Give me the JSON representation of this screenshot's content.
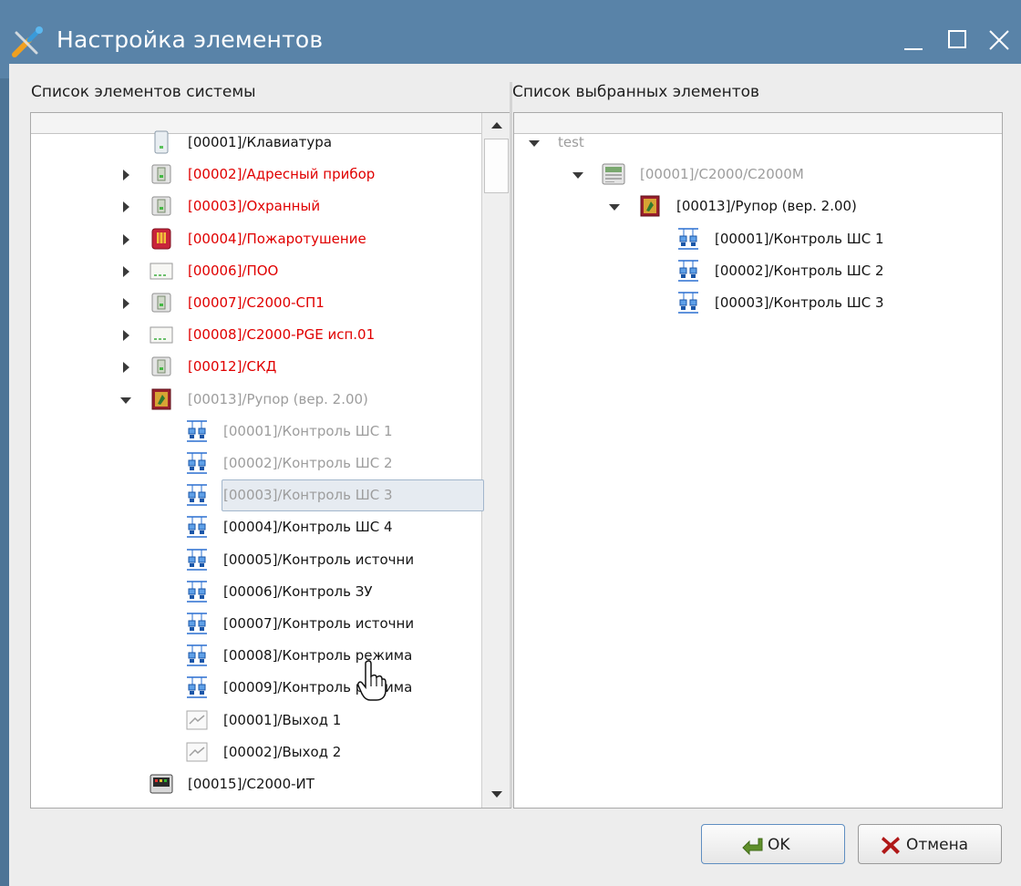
{
  "window": {
    "title": "Настройка элементов",
    "icon": "tools-icon",
    "controls": [
      "minimize-icon",
      "maximize-icon",
      "close-icon"
    ]
  },
  "left_panel": {
    "label": "Список элементов системы",
    "rows": [
      {
        "text": "[00001]/Клавиатура",
        "color": "black",
        "icon": "keyboard-icon",
        "expander": "none",
        "level": 1
      },
      {
        "text": "[00002]/Адресный прибор",
        "color": "red",
        "icon": "device-icon",
        "expander": "collapsed",
        "level": 1
      },
      {
        "text": "[00003]/Охранный",
        "color": "red",
        "icon": "device-icon",
        "expander": "collapsed",
        "level": 1
      },
      {
        "text": "[00004]/Пожаротушение",
        "color": "red",
        "icon": "fire-device-icon",
        "expander": "collapsed",
        "level": 1
      },
      {
        "text": "[00006]/ПОО",
        "color": "red",
        "icon": "panel-device-icon",
        "expander": "collapsed",
        "level": 1
      },
      {
        "text": "[00007]/С2000-СП1",
        "color": "red",
        "icon": "device-icon",
        "expander": "collapsed",
        "level": 1
      },
      {
        "text": "[00008]/С2000-PGE исп.01",
        "color": "red",
        "icon": "panel-device-icon",
        "expander": "collapsed",
        "level": 1
      },
      {
        "text": "[00012]/СКД",
        "color": "red",
        "icon": "device-icon",
        "expander": "collapsed",
        "level": 1
      },
      {
        "text": "[00013]/Рупор (вер. 2.00)",
        "color": "gray",
        "icon": "speaker-device-icon",
        "expander": "expanded",
        "level": 1
      },
      {
        "text": "[00001]/Контроль ШС 1",
        "color": "gray",
        "icon": "zone-control-icon",
        "expander": "none",
        "level": 2
      },
      {
        "text": "[00002]/Контроль ШС 2",
        "color": "gray",
        "icon": "zone-control-icon",
        "expander": "none",
        "level": 2
      },
      {
        "text": "[00003]/Контроль ШС 3",
        "color": "gray",
        "icon": "zone-control-icon",
        "expander": "none",
        "level": 2,
        "selected": true
      },
      {
        "text": "[00004]/Контроль ШС 4",
        "color": "black",
        "icon": "zone-control-icon",
        "expander": "none",
        "level": 2
      },
      {
        "text": "[00005]/Контроль источни",
        "color": "black",
        "icon": "zone-control-icon",
        "expander": "none",
        "level": 2
      },
      {
        "text": "[00006]/Контроль ЗУ",
        "color": "black",
        "icon": "zone-control-icon",
        "expander": "none",
        "level": 2
      },
      {
        "text": "[00007]/Контроль источни",
        "color": "black",
        "icon": "zone-control-icon",
        "expander": "none",
        "level": 2
      },
      {
        "text": "[00008]/Контроль режима",
        "color": "black",
        "icon": "zone-control-icon",
        "expander": "none",
        "level": 2
      },
      {
        "text": "[00009]/Контроль режима",
        "color": "black",
        "icon": "zone-control-icon",
        "expander": "none",
        "level": 2
      },
      {
        "text": "[00001]/Выход 1",
        "color": "black",
        "icon": "output-icon",
        "expander": "none",
        "level": 2
      },
      {
        "text": "[00002]/Выход 2",
        "color": "black",
        "icon": "output-icon",
        "expander": "none",
        "level": 2
      },
      {
        "text": "[00015]/С2000-ИТ",
        "color": "black",
        "icon": "display-device-icon",
        "expander": "none",
        "level": 1
      }
    ]
  },
  "right_panel": {
    "label": "Список выбранных элементов",
    "rows": [
      {
        "text": "test",
        "color": "gray",
        "icon": "",
        "expander": "expanded",
        "level": 0
      },
      {
        "text": "[00001]/С2000/С2000М",
        "color": "gray",
        "icon": "controller-icon",
        "expander": "expanded",
        "level": 1
      },
      {
        "text": "[00013]/Рупор (вер. 2.00)",
        "color": "black",
        "icon": "speaker-device-icon",
        "expander": "expanded",
        "level": 2
      },
      {
        "text": "[00001]/Контроль ШС 1",
        "color": "black",
        "icon": "zone-control-icon",
        "expander": "none",
        "level": 3
      },
      {
        "text": "[00002]/Контроль ШС 2",
        "color": "black",
        "icon": "zone-control-icon",
        "expander": "none",
        "level": 3
      },
      {
        "text": "[00003]/Контроль ШС 3",
        "color": "black",
        "icon": "zone-control-icon",
        "expander": "none",
        "level": 3
      }
    ]
  },
  "buttons": {
    "ok": {
      "label": "OK",
      "icon": "ok-arrow-icon"
    },
    "cancel": {
      "label": "Отмена",
      "icon": "cancel-x-icon"
    }
  }
}
